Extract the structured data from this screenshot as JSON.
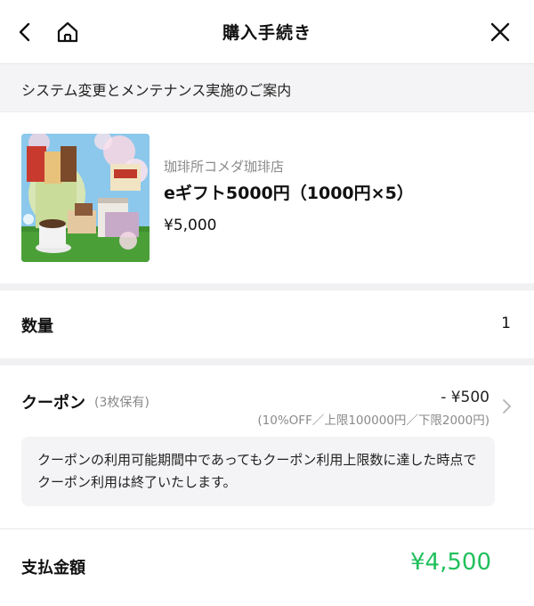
{
  "header": {
    "title": "購入手続き",
    "back_icon": "chevron-left-icon",
    "home_icon": "home-icon",
    "close_icon": "close-icon"
  },
  "notice": {
    "text": "システム変更とメンテナンス実施のご案内"
  },
  "product": {
    "shop_name": "珈琲所コメダ珈琲店",
    "name": "eギフト5000円（1000円×5）",
    "price": "¥5,000"
  },
  "quantity": {
    "label": "数量",
    "value": "1"
  },
  "coupon": {
    "label": "クーポン",
    "owned": "(3枚保有)",
    "discount": "- ¥500",
    "detail": "(10%OFF／上限100000円／下限2000円)",
    "note": "クーポンの利用可能期間中であってもクーポン利用上限数に達した時点でクーポン利用は終了いたします。"
  },
  "total": {
    "label": "支払金額",
    "value": "¥4,500"
  },
  "colors": {
    "accent_green": "#20c05c",
    "section_gap": "#f1f1f3",
    "notice_bg": "#f4f4f6"
  }
}
